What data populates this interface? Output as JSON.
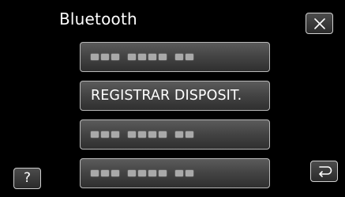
{
  "screen": {
    "title": "Bluetooth"
  },
  "menu": {
    "items": [
      {
        "label": "",
        "placeholder": true
      },
      {
        "label": "REGISTRAR DISPOSIT.",
        "placeholder": false
      },
      {
        "label": "",
        "placeholder": true
      },
      {
        "label": "",
        "placeholder": true
      }
    ]
  },
  "controls": {
    "close_icon": "close-icon",
    "help_label": "?",
    "back_icon": "return-arrow-icon"
  },
  "colors": {
    "background": "#000000",
    "button_border": "#b9b9b9",
    "button_fill": "#454545",
    "text": "#ffffff"
  }
}
